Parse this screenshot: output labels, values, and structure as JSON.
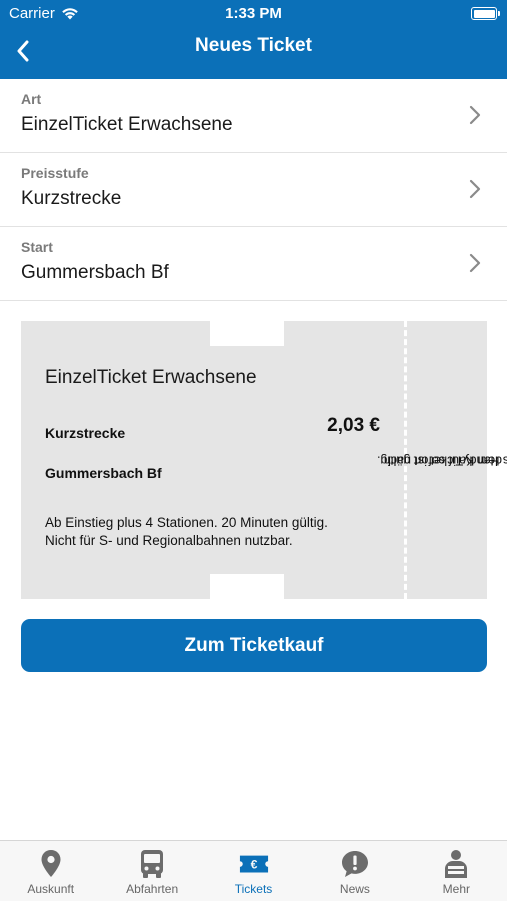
{
  "status_bar": {
    "carrier": "Carrier",
    "time": "1:33 PM"
  },
  "nav": {
    "title": "Neues Ticket",
    "back_icon": "chevron-left-icon"
  },
  "form": {
    "rows": [
      {
        "label": "Art",
        "value": "EinzelTicket Erwachsene"
      },
      {
        "label": "Preisstufe",
        "value": "Kurzstrecke"
      },
      {
        "label": "Start",
        "value": "Gummersbach Bf"
      }
    ]
  },
  "ticket": {
    "title": "EinzelTicket Erwachsene",
    "price_level": "Kurzstrecke",
    "price": "2,03 €",
    "start": "Gummersbach Bf",
    "info_line1": "Ab Einstieg plus 4 Stationen. 20 Minuten gültig.",
    "info_line2": "Nicht für S- und Regionalbahnen nutzbar.",
    "side_line1": "Das HandyTicket ist nach",
    "side_line2": "dem Kauf sofort gültig."
  },
  "buy_button": {
    "label": "Zum Ticketkauf"
  },
  "tab_bar": {
    "active": "Tickets",
    "items": [
      {
        "label": "Auskunft",
        "icon": "location-pin-icon"
      },
      {
        "label": "Abfahrten",
        "icon": "bus-icon"
      },
      {
        "label": "Tickets",
        "icon": "euro-ticket-icon"
      },
      {
        "label": "News",
        "icon": "news-bubble-icon"
      },
      {
        "label": "Mehr",
        "icon": "person-icon"
      }
    ]
  },
  "colors": {
    "brand": "#0b70b8",
    "ticket_bg": "#e5e5e5",
    "tab_inactive": "#666666"
  }
}
